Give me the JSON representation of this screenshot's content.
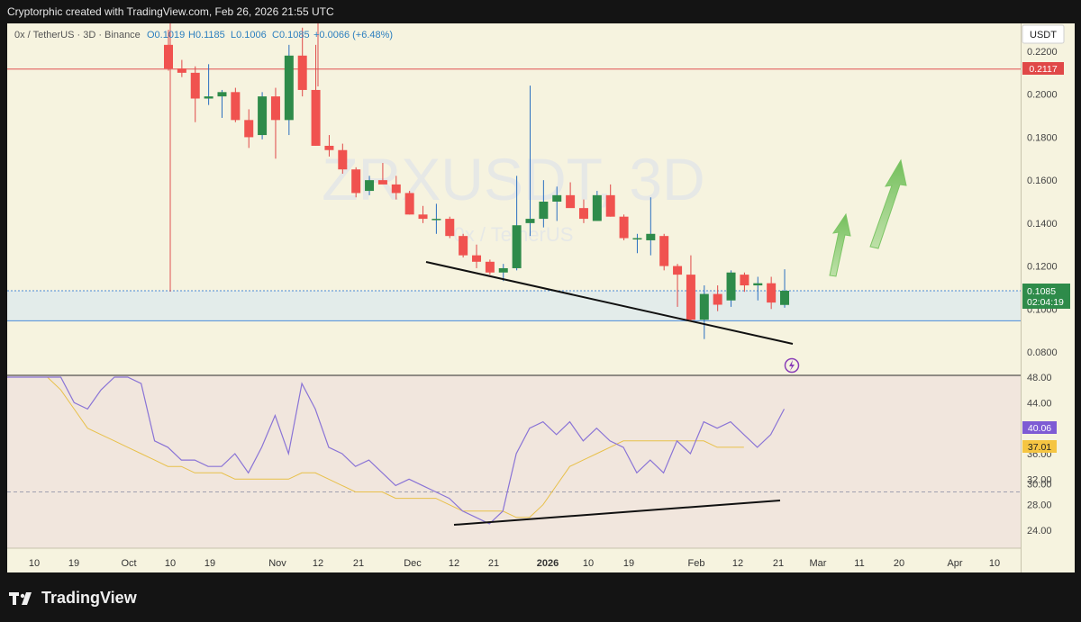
{
  "header": {
    "attribution": "Cryptorphic created with TradingView.com, Feb 26, 2026 21:55 UTC"
  },
  "legend": {
    "symbol": "0x / TetherUS · 3D · Binance",
    "open": "O0.1019",
    "high": "H0.1185",
    "low": "L0.1006",
    "close": "C0.1085",
    "change": "+0.0066 (+6.48%)"
  },
  "watermark": {
    "ticker": "ZRXUSDT, 3D",
    "name": "0x / TetherUS"
  },
  "currency_label": "USDT",
  "price_axis": {
    "ticks": [
      "0.2200",
      "0.2000",
      "0.1800",
      "0.1600",
      "0.1400",
      "0.1200",
      "0.1000",
      "0.0800"
    ],
    "red_level_label": "0.2117",
    "current_price_label": "0.1085",
    "countdown_label": "02:04:19"
  },
  "rsi_axis": {
    "ticks": [
      "48.00",
      "44.00",
      "36.00",
      "32.00",
      "28.00",
      "24.00"
    ],
    "rsi_label": "40.06",
    "ma_label": "37.01",
    "partial_tick": "30.00"
  },
  "time_axis": {
    "labels": [
      "10",
      "19",
      "Oct",
      "10",
      "19",
      "Nov",
      "12",
      "21",
      "Dec",
      "12",
      "21",
      "2026",
      "10",
      "19",
      "Feb",
      "12",
      "21",
      "Mar",
      "11",
      "20",
      "Apr",
      "10"
    ]
  },
  "footer": {
    "brand": "TradingView"
  },
  "colors": {
    "up": "#2e8b4a",
    "down": "#f0524f",
    "rsi": "#8a74d6",
    "rsi_ma": "#e8c04a",
    "red_line": "#e05050",
    "blue_line": "#4a8ad8",
    "arrow": "#86c96a"
  },
  "chart_data": [
    {
      "type": "candlestick",
      "title": "0x / TetherUS · 3D · Binance",
      "ylabel": "USDT",
      "ylim": [
        0.07,
        0.23
      ],
      "horizontal_levels": [
        0.2117,
        0.1085,
        0.0945
      ],
      "series": [
        {
          "o": 0.223,
          "h": 0.23,
          "l": 0.211,
          "c": 0.212
        },
        {
          "o": 0.212,
          "h": 0.216,
          "l": 0.208,
          "c": 0.21
        },
        {
          "o": 0.21,
          "h": 0.213,
          "l": 0.187,
          "c": 0.198
        },
        {
          "o": 0.198,
          "h": 0.214,
          "l": 0.195,
          "c": 0.199
        },
        {
          "o": 0.199,
          "h": 0.202,
          "l": 0.189,
          "c": 0.201
        },
        {
          "o": 0.201,
          "h": 0.203,
          "l": 0.187,
          "c": 0.188
        },
        {
          "o": 0.188,
          "h": 0.193,
          "l": 0.175,
          "c": 0.18
        },
        {
          "o": 0.181,
          "h": 0.201,
          "l": 0.179,
          "c": 0.199
        },
        {
          "o": 0.199,
          "h": 0.203,
          "l": 0.17,
          "c": 0.188
        },
        {
          "o": 0.188,
          "h": 0.223,
          "l": 0.181,
          "c": 0.218
        },
        {
          "o": 0.218,
          "h": 0.231,
          "l": 0.199,
          "c": 0.202
        },
        {
          "o": 0.202,
          "h": 0.223,
          "l": 0.176,
          "c": 0.176
        },
        {
          "o": 0.176,
          "h": 0.181,
          "l": 0.171,
          "c": 0.174
        },
        {
          "o": 0.174,
          "h": 0.177,
          "l": 0.163,
          "c": 0.165
        },
        {
          "o": 0.165,
          "h": 0.166,
          "l": 0.152,
          "c": 0.154
        },
        {
          "o": 0.155,
          "h": 0.162,
          "l": 0.153,
          "c": 0.16
        },
        {
          "o": 0.16,
          "h": 0.168,
          "l": 0.159,
          "c": 0.158
        },
        {
          "o": 0.158,
          "h": 0.162,
          "l": 0.151,
          "c": 0.154
        },
        {
          "o": 0.154,
          "h": 0.155,
          "l": 0.144,
          "c": 0.144
        },
        {
          "o": 0.144,
          "h": 0.148,
          "l": 0.14,
          "c": 0.142
        },
        {
          "o": 0.142,
          "h": 0.149,
          "l": 0.135,
          "c": 0.142
        },
        {
          "o": 0.142,
          "h": 0.143,
          "l": 0.133,
          "c": 0.134
        },
        {
          "o": 0.134,
          "h": 0.135,
          "l": 0.124,
          "c": 0.125
        },
        {
          "o": 0.125,
          "h": 0.13,
          "l": 0.119,
          "c": 0.122
        },
        {
          "o": 0.122,
          "h": 0.123,
          "l": 0.116,
          "c": 0.117
        },
        {
          "o": 0.117,
          "h": 0.121,
          "l": 0.113,
          "c": 0.119
        },
        {
          "o": 0.119,
          "h": 0.162,
          "l": 0.118,
          "c": 0.139
        },
        {
          "o": 0.14,
          "h": 0.204,
          "l": 0.134,
          "c": 0.142
        },
        {
          "o": 0.142,
          "h": 0.16,
          "l": 0.138,
          "c": 0.15
        },
        {
          "o": 0.15,
          "h": 0.157,
          "l": 0.141,
          "c": 0.153
        },
        {
          "o": 0.153,
          "h": 0.159,
          "l": 0.148,
          "c": 0.147
        },
        {
          "o": 0.147,
          "h": 0.151,
          "l": 0.14,
          "c": 0.142
        },
        {
          "o": 0.141,
          "h": 0.155,
          "l": 0.141,
          "c": 0.153
        },
        {
          "o": 0.153,
          "h": 0.158,
          "l": 0.143,
          "c": 0.143
        },
        {
          "o": 0.143,
          "h": 0.144,
          "l": 0.132,
          "c": 0.133
        },
        {
          "o": 0.133,
          "h": 0.135,
          "l": 0.126,
          "c": 0.133
        },
        {
          "o": 0.132,
          "h": 0.152,
          "l": 0.125,
          "c": 0.135
        },
        {
          "o": 0.134,
          "h": 0.135,
          "l": 0.118,
          "c": 0.12
        },
        {
          "o": 0.12,
          "h": 0.121,
          "l": 0.101,
          "c": 0.116
        },
        {
          "o": 0.116,
          "h": 0.125,
          "l": 0.094,
          "c": 0.095
        },
        {
          "o": 0.095,
          "h": 0.111,
          "l": 0.086,
          "c": 0.107
        },
        {
          "o": 0.107,
          "h": 0.111,
          "l": 0.099,
          "c": 0.102
        },
        {
          "o": 0.104,
          "h": 0.118,
          "l": 0.101,
          "c": 0.117
        },
        {
          "o": 0.116,
          "h": 0.117,
          "l": 0.108,
          "c": 0.111
        },
        {
          "o": 0.111,
          "h": 0.115,
          "l": 0.104,
          "c": 0.112
        },
        {
          "o": 0.112,
          "h": 0.115,
          "l": 0.1,
          "c": 0.103
        },
        {
          "o": 0.1019,
          "h": 0.1185,
          "l": 0.1006,
          "c": 0.1085
        }
      ]
    },
    {
      "type": "line",
      "ylim": [
        22.0,
        48.0
      ],
      "series": [
        {
          "values": [
            61,
            58,
            54,
            50,
            48,
            44,
            43,
            46,
            52,
            49,
            47,
            38,
            37,
            35,
            35,
            34,
            34,
            36,
            33,
            37,
            42,
            36,
            47,
            43,
            37,
            36,
            34,
            35,
            33,
            31,
            32,
            31,
            30,
            29,
            27,
            26,
            25,
            27,
            36,
            40,
            41,
            39,
            41,
            38,
            40,
            38,
            37,
            33,
            35,
            33,
            38,
            36,
            41,
            40,
            41,
            39,
            37,
            39,
            43
          ]
        },
        {
          "values": [
            55,
            53,
            51,
            49,
            46,
            43,
            40,
            39,
            38,
            37,
            36,
            35,
            34,
            34,
            33,
            33,
            33,
            32,
            32,
            32,
            32,
            32,
            33,
            33,
            32,
            31,
            30,
            30,
            30,
            29,
            29,
            29,
            29,
            28,
            27,
            27,
            27,
            27,
            26,
            26,
            28,
            31,
            34,
            35,
            36,
            37,
            38,
            38,
            38,
            38,
            38,
            38,
            38,
            37,
            37,
            37
          ]
        }
      ]
    }
  ]
}
